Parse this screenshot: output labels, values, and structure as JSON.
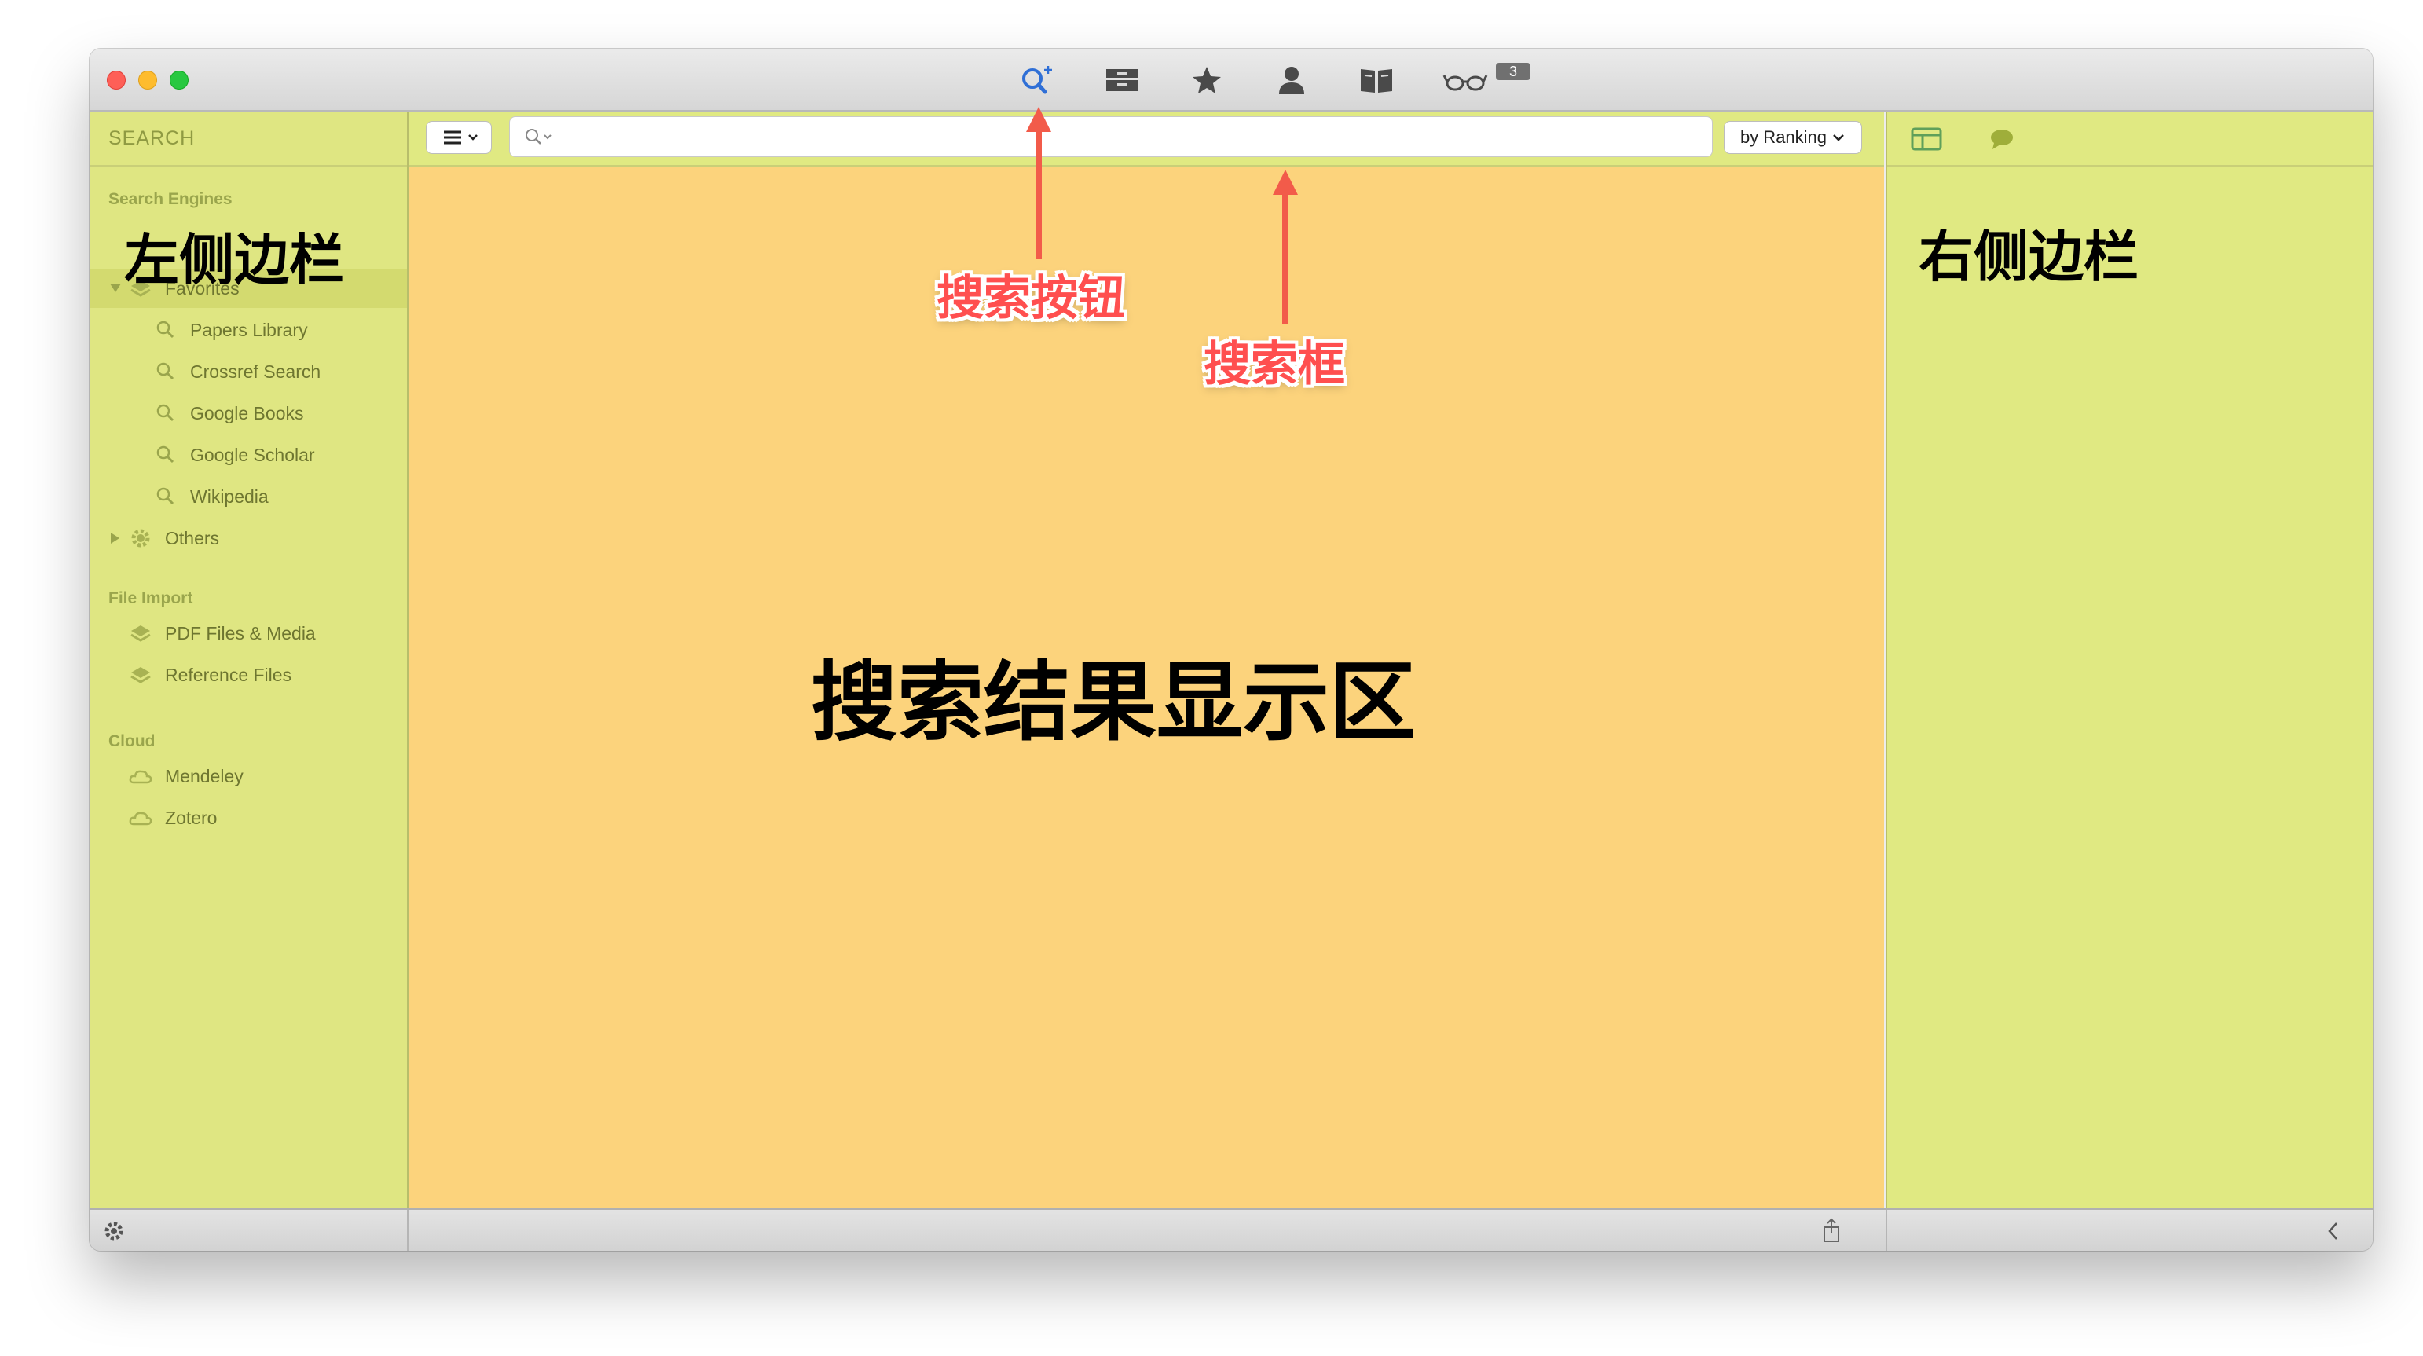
{
  "toolbar": {
    "icons": [
      "search-add-icon",
      "archive-icon",
      "star-icon",
      "person-icon",
      "book-icon",
      "glasses-icon"
    ],
    "badge": "3",
    "active_color": "#2f6fd6"
  },
  "left_sidebar": {
    "title": "SEARCH",
    "sections": {
      "search_engines": {
        "label": "Search Engines",
        "favorites_label": "Favorites",
        "items": [
          "Papers Library",
          "Crossref Search",
          "Google Books",
          "Google Scholar",
          "Wikipedia"
        ],
        "others_label": "Others"
      },
      "file_import": {
        "label": "File Import",
        "items": [
          "PDF Files & Media",
          "Reference Files"
        ]
      },
      "cloud": {
        "label": "Cloud",
        "items": [
          "Mendeley",
          "Zotero"
        ]
      }
    }
  },
  "search": {
    "sort_label": "by Ranking"
  },
  "annotations": {
    "left_sidebar": "左侧边栏",
    "right_sidebar": "右侧边栏",
    "results_area": "搜索结果显示区",
    "search_button": "搜索按钮",
    "search_box": "搜索框"
  },
  "colors": {
    "sidebar": "#dfe682",
    "results": "#fcd37c",
    "arrow": "#f25b4a"
  }
}
